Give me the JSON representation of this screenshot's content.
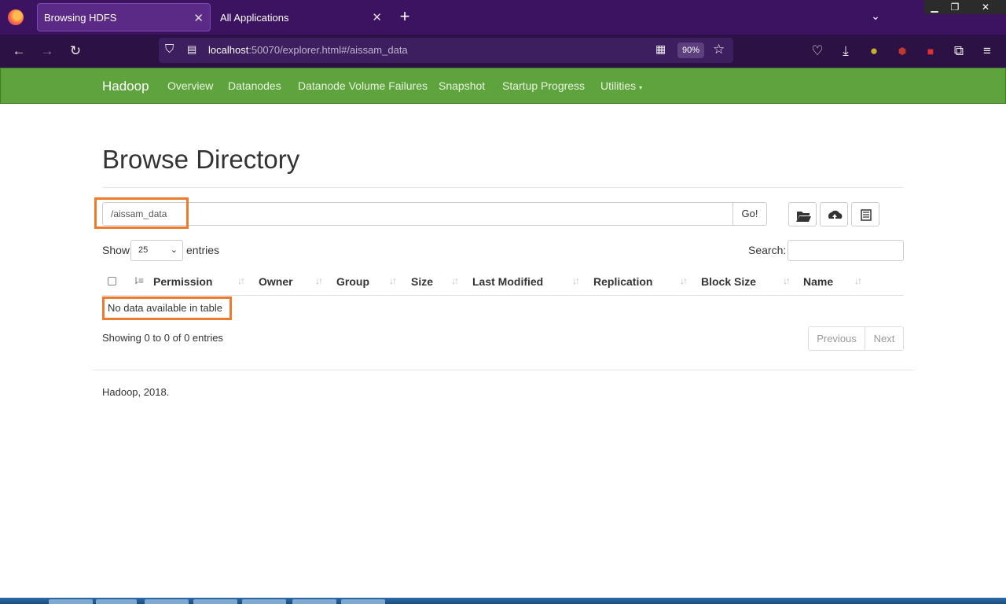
{
  "browser": {
    "tabs": [
      {
        "title": "Browsing HDFS",
        "active": true
      },
      {
        "title": "All Applications",
        "active": false
      }
    ],
    "url": {
      "host": "localhost",
      "rest": ":50070/explorer.html#/aissam_data"
    },
    "zoom": "90%",
    "icons": [
      "firefox-logo",
      "back-arrow",
      "forward-arrow",
      "reload",
      "shield",
      "page",
      "reader-mode",
      "bookmark-star",
      "pocket",
      "download",
      "extension",
      "menu"
    ]
  },
  "hadoop_nav": {
    "brand": "Hadoop",
    "items": [
      "Overview",
      "Datanodes",
      "Datanode Volume Failures",
      "Snapshot",
      "Startup Progress",
      "Utilities"
    ]
  },
  "main": {
    "title": "Browse Directory",
    "path_value": "/aissam_data",
    "go_label": "Go!",
    "show_label": "Show",
    "entries_value": "25",
    "entries_label": "entries",
    "search_label": "Search:",
    "columns": [
      "Permission",
      "Owner",
      "Group",
      "Size",
      "Last Modified",
      "Replication",
      "Block Size",
      "Name"
    ],
    "empty_message": "No data available in table",
    "info": "Showing 0 to 0 of 0 entries",
    "prev_label": "Previous",
    "next_label": "Next",
    "footer": "Hadoop, 2018."
  },
  "colors": {
    "hadoop_green": "#5fa33e",
    "highlight_orange": "#ee7b2d",
    "browser_purple": "#3c1361"
  }
}
